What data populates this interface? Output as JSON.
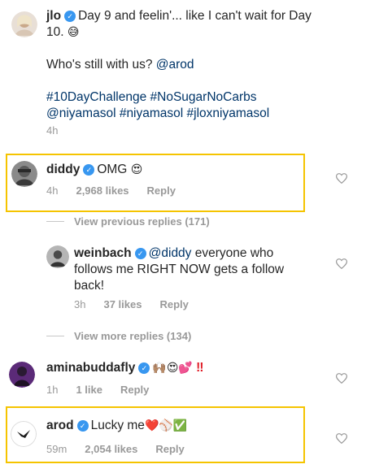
{
  "post": {
    "username": "jlo",
    "caption_line1": "Day 9 and feelin'... like I can't wait for Day",
    "caption_line2": "10.",
    "caption_question": "Who's still with us?",
    "caption_mention": "@arod",
    "hashtags_line1": "#10DayChallenge #NoSugarNoCarbs",
    "hashtags_line2": "@niyamasol #niyamasol #jloxniyamasol",
    "time": "4h",
    "emoji": "😅"
  },
  "comments": [
    {
      "username": "diddy",
      "text": "OMG",
      "emoji": "😍",
      "time": "4h",
      "likes": "2,968 likes",
      "reply_label": "Reply"
    },
    {
      "username": "weinbach",
      "mention": "@diddy",
      "text_line1": "everyone who",
      "text_line2": "follows me RIGHT NOW gets a follow",
      "text_line3": "back!",
      "time": "3h",
      "likes": "37 likes",
      "reply_label": "Reply"
    },
    {
      "username": "aminabuddafly",
      "emoji": "🙌🏽😍💕",
      "exclaim": "‼",
      "time": "1h",
      "likes": "1 like",
      "reply_label": "Reply"
    },
    {
      "username": "arod",
      "text": "Lucky me",
      "emoji": "❤️⚾✅",
      "time": "59m",
      "likes": "2,054 likes",
      "reply_label": "Reply"
    }
  ],
  "view_previous": "View previous replies (171)",
  "view_more": "View more replies (134)",
  "colors": {
    "highlight": "#f5c400",
    "verified": "#3897f0",
    "link": "#003569",
    "meta": "#999999"
  }
}
